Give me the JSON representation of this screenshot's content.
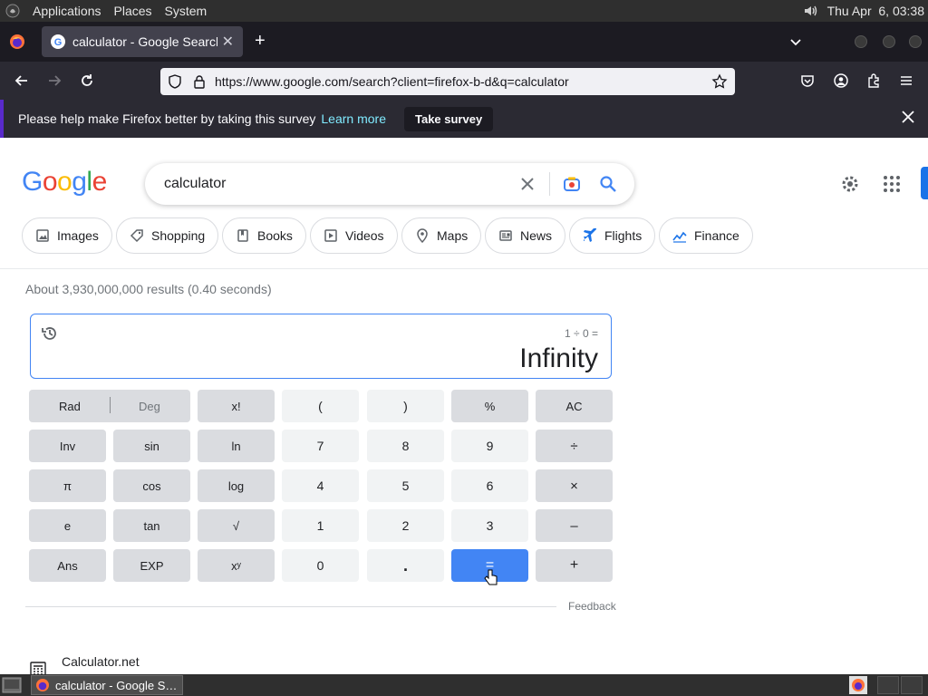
{
  "gnome_panel": {
    "menus": [
      "Applications",
      "Places",
      "System"
    ],
    "clock": "Thu Apr  6, 03:38"
  },
  "browser": {
    "tab_title": "calculator - Google Search",
    "url": "https://www.google.com/search?client=firefox-b-d&q=calculator",
    "notification": {
      "message": "Please help make Firefox better by taking this survey",
      "link": "Learn more",
      "button": "Take survey"
    }
  },
  "google": {
    "logo": "Google",
    "query": "calculator",
    "chips": [
      "Images",
      "Shopping",
      "Books",
      "Videos",
      "Maps",
      "News",
      "Flights",
      "Finance"
    ],
    "stats": "About 3,930,000,000 results (0.40 seconds)",
    "calculator": {
      "expression": "1 ÷ 0 =",
      "result": "Infinity",
      "keys": [
        [
          "Rad",
          "Deg",
          "x!",
          "(",
          ")",
          "%",
          "AC"
        ],
        [
          "Inv",
          "sin",
          "ln",
          "7",
          "8",
          "9",
          "÷"
        ],
        [
          "π",
          "cos",
          "log",
          "4",
          "5",
          "6",
          "×"
        ],
        [
          "e",
          "tan",
          "√",
          "1",
          "2",
          "3",
          "–"
        ],
        [
          "Ans",
          "EXP",
          "xʸ",
          "0",
          ".",
          "=",
          "+"
        ]
      ]
    },
    "feedback": "Feedback",
    "first_result": "Calculator.net"
  },
  "taskbar": {
    "item": "calculator - Google S…"
  },
  "colors": {
    "google_blue": "#4285f4",
    "key_function": "#dadce0",
    "key_number": "#f1f3f4",
    "firefox_dark": "#2b2a33"
  }
}
